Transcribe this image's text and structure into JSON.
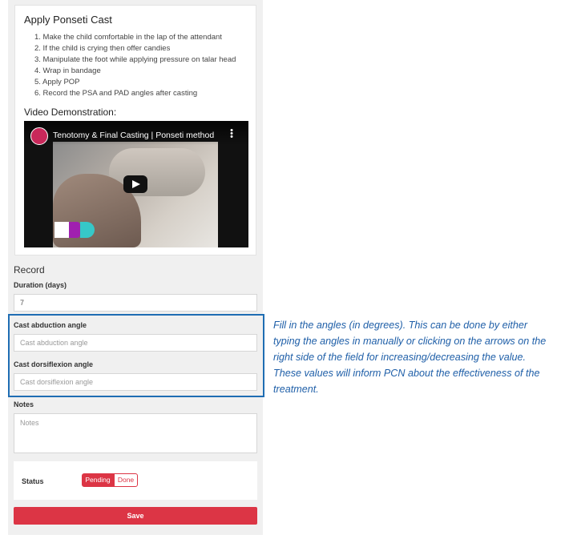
{
  "card": {
    "title": "Apply Ponseti Cast",
    "steps": [
      "1. Make the child comfortable in the lap of the attendant",
      "2. If the child is crying then offer candies",
      "3. Manipulate the foot while applying pressure on talar head",
      "4. Wrap in bandage",
      "5. Apply POP",
      "6. Record the PSA and PAD angles after casting"
    ],
    "video_heading": "Video Demonstration:",
    "video": {
      "title": "Tenotomy & Final Casting | Ponseti method",
      "icons": [
        "channel-logo",
        "kebab-menu-icon",
        "play-icon"
      ]
    }
  },
  "record": {
    "title": "Record",
    "duration": {
      "label": "Duration (days)",
      "value": "7"
    },
    "abduction": {
      "label": "Cast abduction angle",
      "placeholder": "Cast abduction angle",
      "value": ""
    },
    "dorsiflexion": {
      "label": "Cast dorsiflexion angle",
      "placeholder": "Cast dorsiflexion angle",
      "value": ""
    },
    "notes": {
      "label": "Notes",
      "placeholder": "Notes",
      "value": ""
    },
    "status": {
      "label": "Status",
      "options": [
        "Pending",
        "Done"
      ],
      "selected": "Pending"
    },
    "save_label": "Save"
  },
  "annotation": {
    "text": "Fill in the angles (in degrees). This can be done by either typing the angles in manually or clicking  on the arrows on the right side of the field for increasing/decreasing the value. These values will inform PCN about the effectiveness of the treatment.",
    "color": "#1f6db3"
  },
  "colors": {
    "accent": "#dc3545",
    "annotation_border": "#1f6db3"
  }
}
